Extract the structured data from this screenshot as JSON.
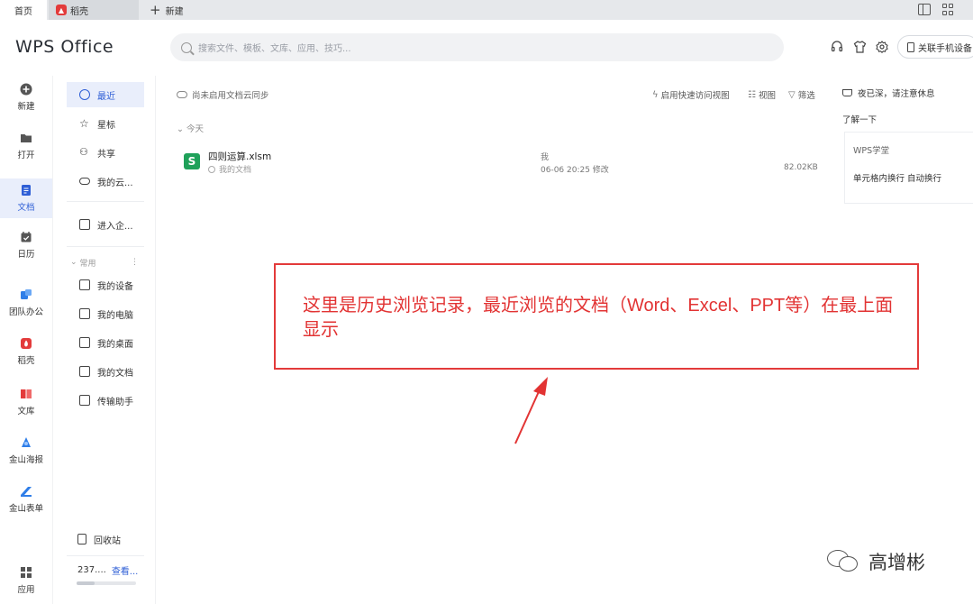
{
  "tabs": {
    "home": "首页",
    "daoke": "稻壳",
    "new": "新建"
  },
  "header": {
    "logo": "WPS Office",
    "search_placeholder": "搜索文件、模板、文库、应用、技巧...",
    "link_phone": "关联手机设备"
  },
  "rail": {
    "items": [
      {
        "label": "新建",
        "icon": "plus-circle-icon",
        "color": "#555555"
      },
      {
        "label": "打开",
        "icon": "folder-icon",
        "color": "#555555"
      },
      {
        "label": "文档",
        "icon": "document-icon",
        "color": "#2f5fd6"
      },
      {
        "label": "日历",
        "icon": "calendar-icon",
        "color": "#555555"
      },
      {
        "label": "团队办公",
        "icon": "team-icon",
        "color": "#2f7ee8"
      },
      {
        "label": "稻壳",
        "icon": "daoke-icon",
        "color": "#e33b3b"
      },
      {
        "label": "文库",
        "icon": "library-icon",
        "color": "#e33b3b"
      },
      {
        "label": "金山海报",
        "icon": "poster-icon",
        "color": "#2f7ee8"
      },
      {
        "label": "金山表单",
        "icon": "form-icon",
        "color": "#2f7ee8"
      },
      {
        "label": "应用",
        "icon": "apps-grid-icon",
        "color": "#555555"
      }
    ]
  },
  "nav": {
    "recent": "最近",
    "starred": "星标",
    "shared": "共享",
    "mycloud": "我的云...",
    "enterprise": "进入企...",
    "group_common": "常用",
    "group_more": "⋮",
    "my_device": "我的设备",
    "my_pc": "我的电脑",
    "my_desktop": "我的桌面",
    "my_docs": "我的文档",
    "transfer": "传输助手",
    "recycle": "回收站",
    "storage_text": "237....",
    "storage_link": "查看...",
    "storage_fraction": 0.3
  },
  "main": {
    "sync_note": "尚未启用文档云同步",
    "quick_view": "启用快速访问视图",
    "view": "视图",
    "filter": "筛选",
    "section_today": "今天",
    "files": [
      {
        "name": "四则运算.xlsm",
        "location": "我的文档",
        "owner": "我",
        "modified": "06-06 20:25 修改",
        "size": "82.02KB",
        "type_icon": "S"
      }
    ]
  },
  "side": {
    "greeting": "夜已深，请注意休息",
    "learn": "了解一下",
    "card_title": "WPS学堂",
    "card_tip": "单元格内换行 自动换行"
  },
  "annotation": {
    "text": "这里是历史浏览记录，最近浏览的文档（Word、Excel、PPT等）在最上面显示",
    "color": "#e23333"
  },
  "watermark": {
    "text": "高增彬"
  }
}
